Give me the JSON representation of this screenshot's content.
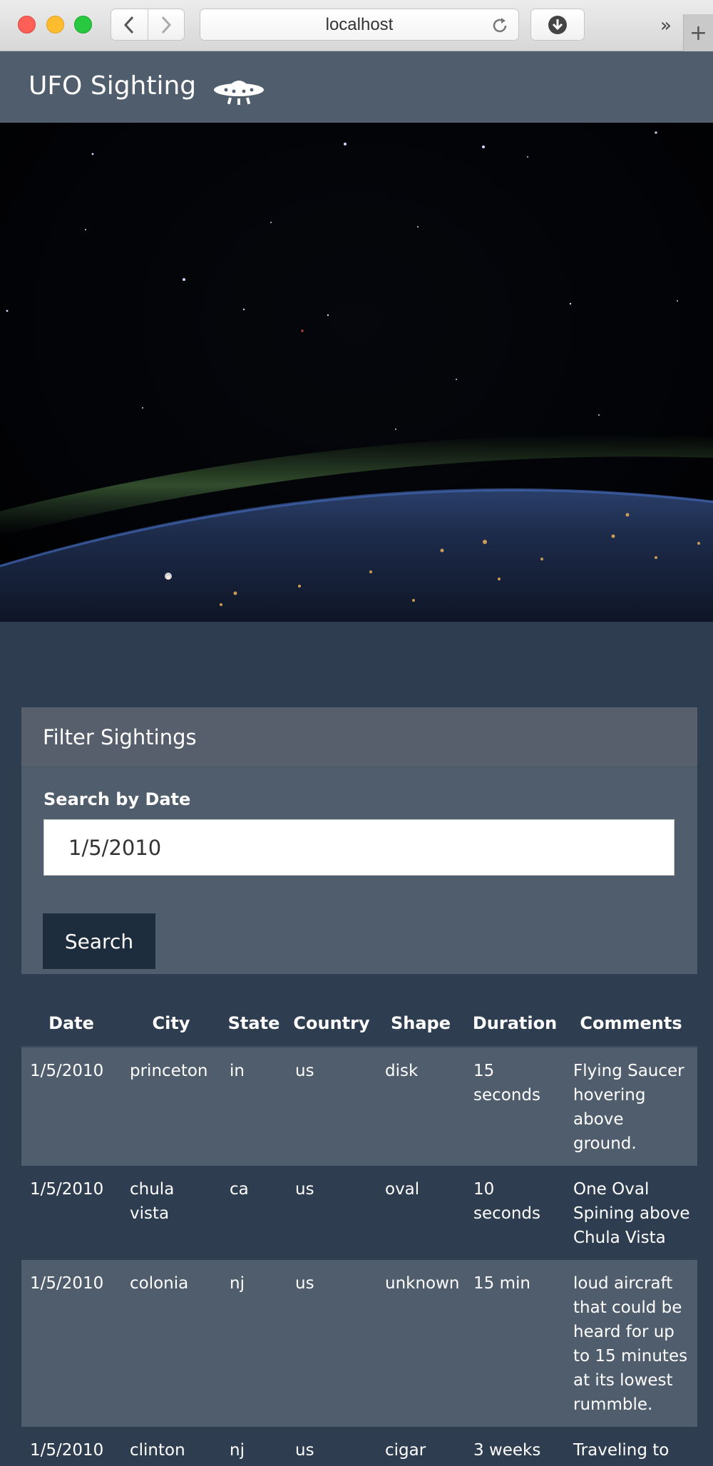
{
  "browser": {
    "url": "localhost"
  },
  "navbar": {
    "brand": "UFO Sighting",
    "icon": "ufo-icon"
  },
  "filter": {
    "title": "Filter Sightings",
    "date_label": "Search by Date",
    "date_value": "1/5/2010",
    "search_label": "Search"
  },
  "table": {
    "headers": [
      "Date",
      "City",
      "State",
      "Country",
      "Shape",
      "Duration",
      "Comments"
    ],
    "rows": [
      {
        "date": "1/5/2010",
        "city": "princeton",
        "state": "in",
        "country": "us",
        "shape": "disk",
        "duration": "15 seconds",
        "comments": "Flying Saucer hovering above ground."
      },
      {
        "date": "1/5/2010",
        "city": "chula vista",
        "state": "ca",
        "country": "us",
        "shape": "oval",
        "duration": "10 seconds",
        "comments": "One Oval Spining above Chula Vista"
      },
      {
        "date": "1/5/2010",
        "city": "colonia",
        "state": "nj",
        "country": "us",
        "shape": "unknown",
        "duration": "15 min",
        "comments": "loud aircraft that could be heard for up to 15 minutes at its lowest rummble."
      },
      {
        "date": "1/5/2010",
        "city": "clinton",
        "state": "nj",
        "country": "us",
        "shape": "cigar",
        "duration": "3 weeks",
        "comments": "Traveling to Pennylvania."
      }
    ]
  },
  "colors": {
    "page_bg": "#2e3e50",
    "panel_bg": "#505d6d",
    "button_bg": "#1e2d3e"
  }
}
